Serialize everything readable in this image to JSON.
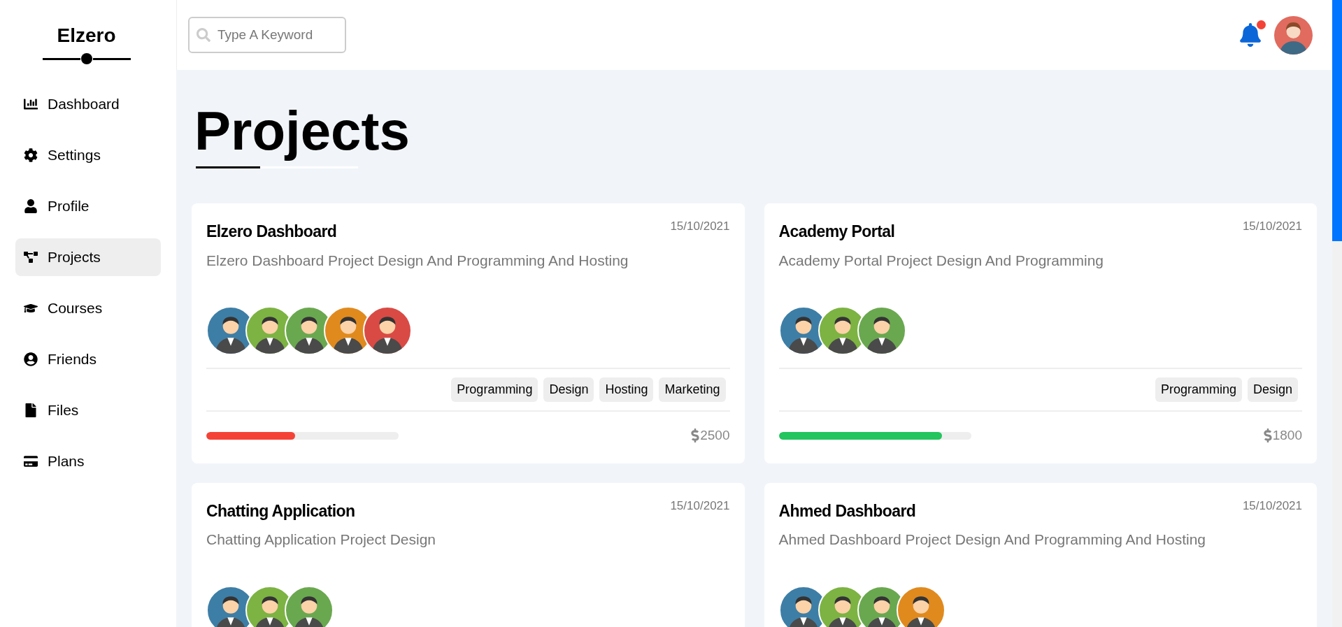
{
  "brand": {
    "name": "Elzero"
  },
  "sidebar": {
    "items": [
      {
        "label": "Dashboard",
        "kind": "chart",
        "selected": false
      },
      {
        "label": "Settings",
        "kind": "gear",
        "selected": false
      },
      {
        "label": "Profile",
        "kind": "user",
        "selected": false
      },
      {
        "label": "Projects",
        "kind": "diagram",
        "selected": true
      },
      {
        "label": "Courses",
        "kind": "cap",
        "selected": false
      },
      {
        "label": "Friends",
        "kind": "circle-user",
        "selected": false
      },
      {
        "label": "Files",
        "kind": "file",
        "selected": false
      },
      {
        "label": "Plans",
        "kind": "card",
        "selected": false
      }
    ]
  },
  "header": {
    "search": {
      "placeholder": "Type A Keyword"
    },
    "notifications": {
      "unread": true
    }
  },
  "page_title": "Projects",
  "projects": [
    {
      "title": "Elzero Dashboard",
      "date": "15/10/2021",
      "description": "Elzero Dashboard Project Design And Programming And Hosting",
      "members": [
        {
          "color": "#3d7ea6"
        },
        {
          "color": "#7cb342"
        },
        {
          "color": "#6aa84f"
        },
        {
          "color": "#e08a1e"
        },
        {
          "color": "#d94a45"
        }
      ],
      "tags": [
        "Programming",
        "Design",
        "Hosting",
        "Marketing"
      ],
      "progress": {
        "level": 0.46,
        "color": "#f44336"
      },
      "price": "2500"
    },
    {
      "title": "Academy Portal",
      "date": "15/10/2021",
      "description": "Academy Portal Project Design And Programming",
      "members": [
        {
          "color": "#3d7ea6"
        },
        {
          "color": "#7cb342"
        },
        {
          "color": "#6aa84f"
        }
      ],
      "tags": [
        "Programming",
        "Design"
      ],
      "progress": {
        "level": 0.85,
        "color": "#22c55e"
      },
      "price": "1800"
    },
    {
      "title": "Chatting Application",
      "date": "15/10/2021",
      "description": "Chatting Application Project Design",
      "members": [
        {
          "color": "#3d7ea6"
        },
        {
          "color": "#7cb342"
        },
        {
          "color": "#6aa84f"
        }
      ]
    },
    {
      "title": "Ahmed Dashboard",
      "date": "15/10/2021",
      "description": "Ahmed Dashboard Project Design And Programming And Hosting",
      "members": [
        {
          "color": "#3d7ea6"
        },
        {
          "color": "#7cb342"
        },
        {
          "color": "#6aa84f"
        },
        {
          "color": "#e08a1e"
        }
      ]
    }
  ]
}
